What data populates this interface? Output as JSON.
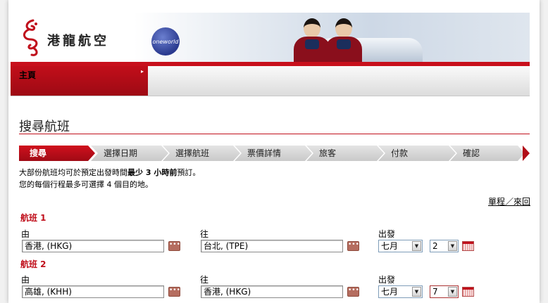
{
  "header": {
    "logo_text": "港龍航空",
    "oneworld_text": "oneworld"
  },
  "nav": {
    "home_label": "主頁",
    "home_arrow": "▸"
  },
  "page": {
    "title": "搜尋航班"
  },
  "steps": [
    {
      "label": "搜尋",
      "active": true
    },
    {
      "label": "選擇日期",
      "active": false
    },
    {
      "label": "選擇航班",
      "active": false
    },
    {
      "label": "票價詳情",
      "active": false
    },
    {
      "label": "旅客",
      "active": false
    },
    {
      "label": "付款",
      "active": false
    },
    {
      "label": "確認",
      "active": false
    }
  ],
  "notes": {
    "line1_pre": "大部份航班均可於預定出發時間",
    "line1_bold": "最少 3 小時前",
    "line1_post": "預訂。",
    "line2": "您的每個行程最多可選擇 4 個目的地。"
  },
  "trip_type_link": "單程／來回",
  "labels": {
    "from": "由",
    "to": "往",
    "depart": "出發",
    "more_button": "•••"
  },
  "flights": [
    {
      "title": "航班 1",
      "from_value": "香港, (HKG)",
      "to_value": "台北, (TPE)",
      "month_value": "七月",
      "day_value": "2"
    },
    {
      "title": "航班 2",
      "from_value": "高雄, (KHH)",
      "to_value": "香港, (HKG)",
      "month_value": "七月",
      "day_value": "7"
    }
  ],
  "colors": {
    "brand_red": "#c0101c",
    "link_text": "#000000"
  }
}
